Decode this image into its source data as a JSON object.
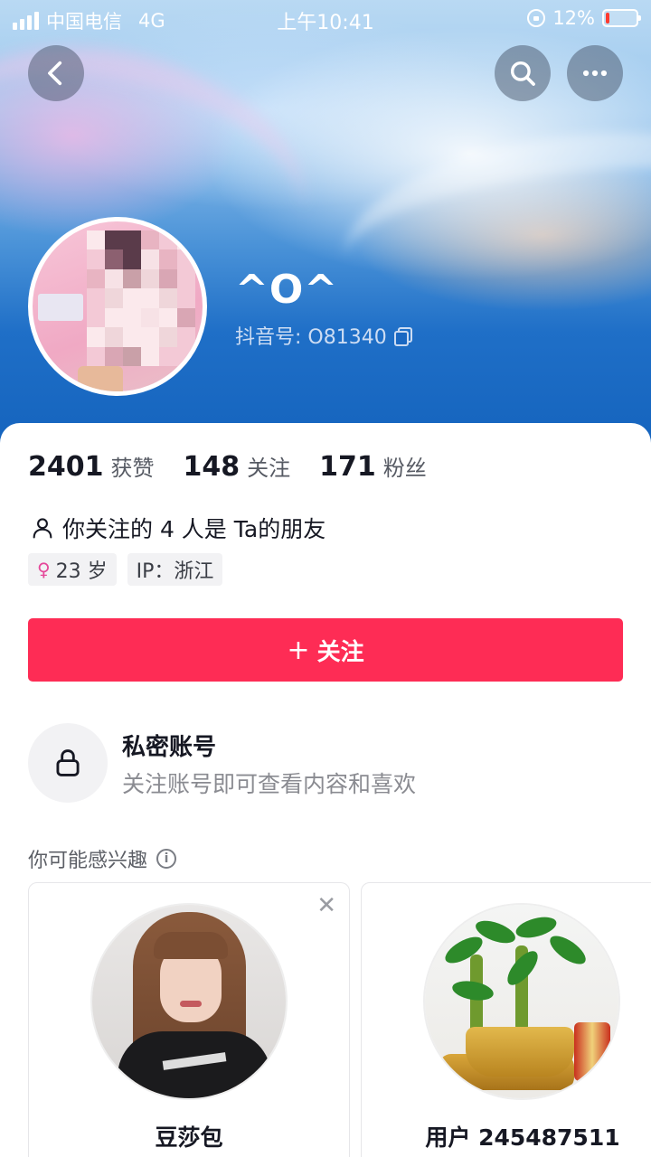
{
  "status_bar": {
    "carrier": "中国电信",
    "network": "4G",
    "time": "上午10:41",
    "battery_percent": "12%",
    "battery_level": 0.12
  },
  "header": {
    "back_icon": "chevron-left-icon",
    "search_icon": "search-icon",
    "more_icon": "more-dots-icon"
  },
  "profile": {
    "username": "^O^",
    "douyin_id": "抖音号: O81340"
  },
  "stats": [
    {
      "value": "2401",
      "label": "获赞"
    },
    {
      "value": "148",
      "label": "关注"
    },
    {
      "value": "171",
      "label": "粉丝"
    }
  ],
  "friends_text": "你关注的 4 人是 Ta的朋友",
  "tags": {
    "age": "23 岁",
    "ip": "IP：浙江"
  },
  "follow_button": {
    "plus": "+",
    "label": "关注"
  },
  "private_account": {
    "title": "私密账号",
    "description": "关注账号即可查看内容和喜欢"
  },
  "recommendations": {
    "title": "你可能感兴趣",
    "close": "✕",
    "items": [
      {
        "name": "豆莎包"
      },
      {
        "name": "用户 245487511"
      }
    ]
  },
  "colors": {
    "accent": "#fe2c55",
    "text": "#161823",
    "muted": "#8a8b91"
  }
}
